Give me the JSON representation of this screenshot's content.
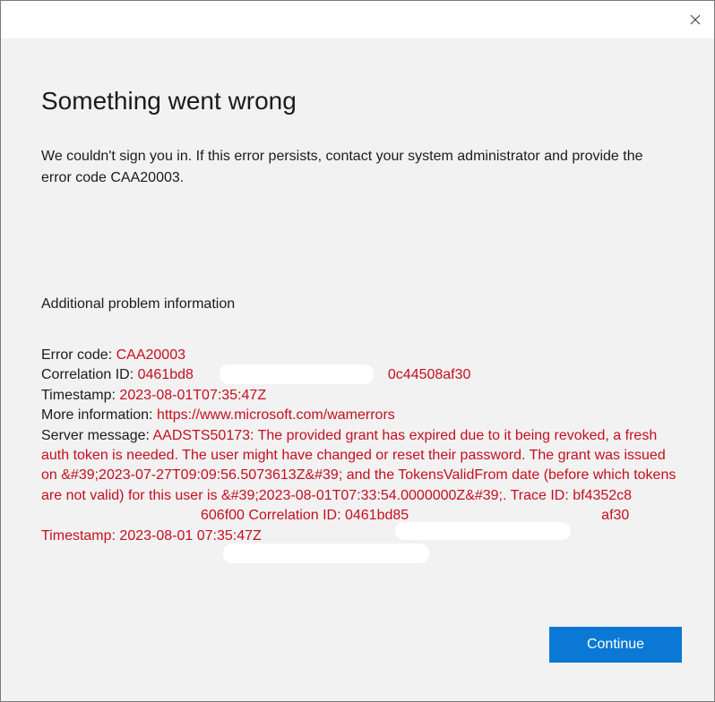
{
  "dialog": {
    "close_icon": "close-icon",
    "heading": "Something went wrong",
    "description": "We couldn't sign you in. If this error persists, contact your system administrator and provide the error code CAA20003.",
    "section_title": "Additional problem information",
    "details": {
      "error_code_label": "Error code: ",
      "error_code_value": "CAA20003",
      "correlation_label": "Correlation ID: ",
      "correlation_value_visible_start": "0461bd8",
      "correlation_value_visible_end": "0c44508af30",
      "timestamp_label": "Timestamp: ",
      "timestamp_value": "2023-08-01T07:35:47Z",
      "more_info_label": "More information: ",
      "more_info_value": "https://www.microsoft.com/wamerrors",
      "server_message_label": "Server message: ",
      "server_message_part1": "AADSTS50173: The provided grant has expired due to it being revoked, a fresh auth token is needed. The user might have changed or reset their password. The grant was issued on &#39;2023-07-27T09:09:56.5073613Z&#39; and the TokensValidFrom date (before which tokens are not valid) for this user is &#39;2023-08-01T07:33:54.0000000Z&#39;. Trace ID: bf4352c8",
      "server_message_part2": "606f00 Correlation ID: 0461bd85",
      "server_message_part3": "af30 Timestamp: 2023-08-01 07:35:47Z"
    },
    "continue_label": "Continue",
    "accent_color": "#0a78d4",
    "error_color": "#c50f1f"
  }
}
